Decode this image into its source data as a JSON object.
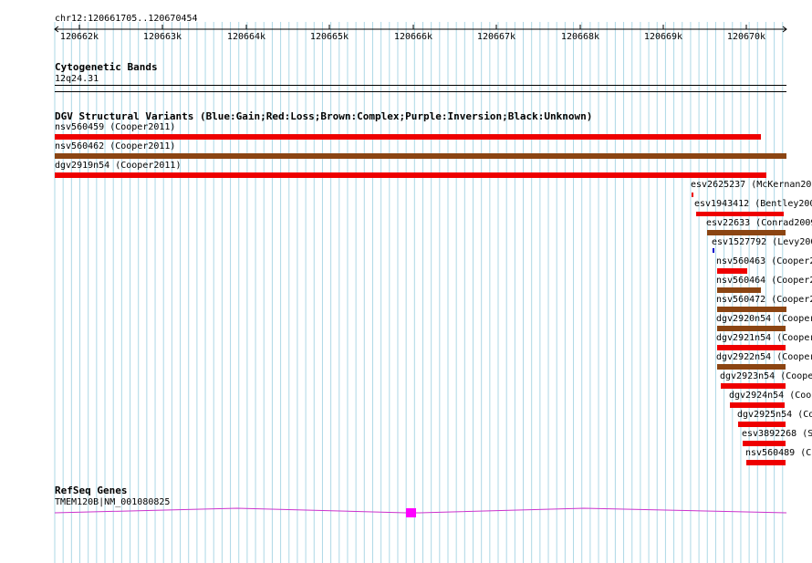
{
  "ruler": {
    "location": "chr12:120661705..120670454",
    "ticks": [
      "120662k",
      "120663k",
      "120664k",
      "120665k",
      "120666k",
      "120667k",
      "120668k",
      "120669k",
      "120670k"
    ]
  },
  "cytoband": {
    "title": "Cytogenetic Bands",
    "band": "12q24.31"
  },
  "dgv": {
    "title": "DGV Structural Variants (Blue:Gain;Red:Loss;Brown:Complex;Purple:Inversion;Black:Unknown)",
    "colors": {
      "loss": "#ee0000",
      "complex": "#8b4513",
      "gain": "#0000cc"
    },
    "features": [
      {
        "label": "nsv560459 (Cooper2011)",
        "type": "loss"
      },
      {
        "label": "nsv560462 (Cooper2011)",
        "type": "complex"
      },
      {
        "label": "dgv2919n54 (Cooper2011)",
        "type": "loss"
      },
      {
        "label": "esv2625237 (McKernan20",
        "type": "loss"
      },
      {
        "label": "esv1943412 (Bentley200",
        "type": "loss"
      },
      {
        "label": "esv22633 (Conrad2009",
        "type": "complex"
      },
      {
        "label": "esv1527792 (Levy200",
        "type": "gain"
      },
      {
        "label": "nsv560463 (Cooper2",
        "type": "loss"
      },
      {
        "label": "nsv560464 (Cooper2",
        "type": "complex"
      },
      {
        "label": "nsv560472 (Cooper2",
        "type": "complex"
      },
      {
        "label": "dgv2920n54 (Cooper",
        "type": "complex"
      },
      {
        "label": "dgv2921n54 (Cooper",
        "type": "loss"
      },
      {
        "label": "dgv2922n54 (Cooper",
        "type": "complex"
      },
      {
        "label": "dgv2923n54 (Coope",
        "type": "loss"
      },
      {
        "label": "dgv2924n54 (Coo",
        "type": "loss"
      },
      {
        "label": "dgv2925n54 (Co",
        "type": "loss"
      },
      {
        "label": "esv3892268 (S",
        "type": "loss"
      },
      {
        "label": "nsv560489 (C",
        "type": "loss"
      }
    ]
  },
  "refseq": {
    "title": "RefSeq Genes",
    "gene": "TMEM120B|NM_001080825",
    "color": "#cc33cc",
    "exon_color": "#ff00ff"
  }
}
